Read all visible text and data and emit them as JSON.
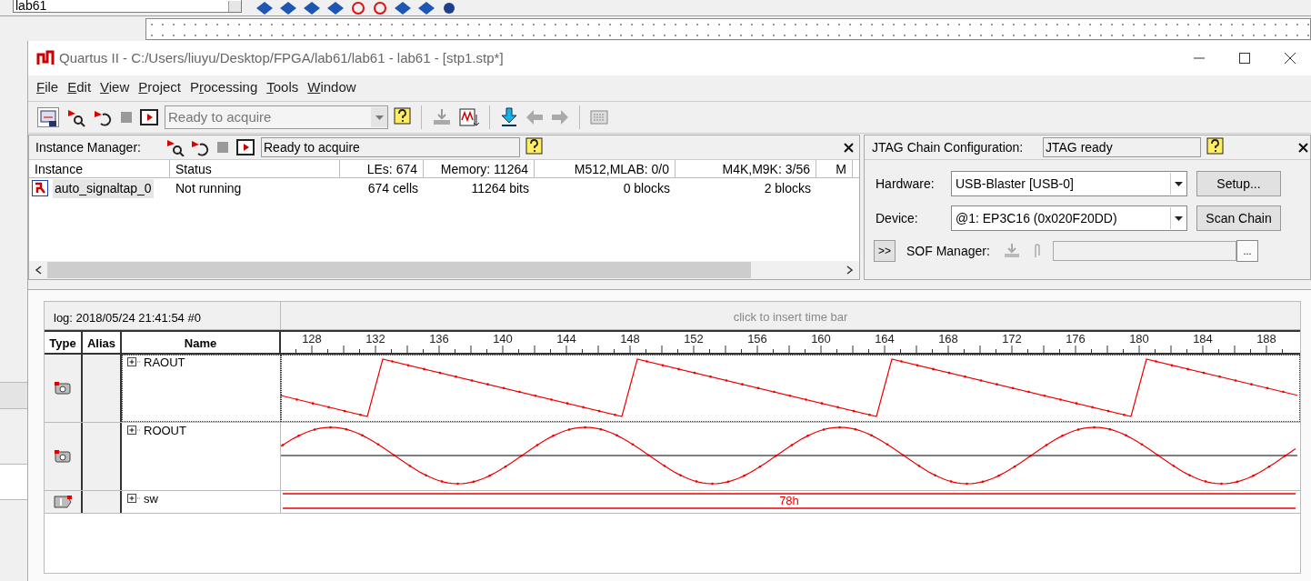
{
  "background_app": {
    "project_combo": "lab61"
  },
  "window": {
    "title": "Quartus II - C:/Users/liuyu/Desktop/FPGA/lab61/lab61 - lab61 - [stp1.stp*]"
  },
  "menu": [
    {
      "label": "File"
    },
    {
      "label": "Edit"
    },
    {
      "label": "View"
    },
    {
      "label": "Project"
    },
    {
      "label": "Processing"
    },
    {
      "label": "Tools"
    },
    {
      "label": "Window"
    }
  ],
  "toolbar": {
    "status_combo": "Ready to acquire"
  },
  "instance_manager": {
    "label": "Instance Manager:",
    "status": "Ready to acquire",
    "columns": [
      "Instance",
      "Status",
      "LEs: 674",
      "Memory: 11264",
      "M512,MLAB: 0/0",
      "M4K,M9K: 3/56",
      "M"
    ],
    "rows": [
      {
        "selected": true,
        "cells": [
          "auto_signaltap_0",
          "Not running",
          "674 cells",
          "11264 bits",
          "0 blocks",
          "2 blocks"
        ]
      }
    ]
  },
  "jtag": {
    "label": "JTAG Chain Configuration:",
    "status": "JTAG ready",
    "hardware_label": "Hardware:",
    "hardware": "USB-Blaster [USB-0]",
    "setup_button": "Setup...",
    "device_label": "Device:",
    "device": "@1: EP3C16 (0x020F20DD)",
    "scan_button": "Scan Chain",
    "expand_button": ">>",
    "sof_label": "SOF Manager:",
    "browse_button": "..."
  },
  "waveform": {
    "log": "log: 2018/05/24 21:41:54  #0",
    "time_bar_hint": "click to insert time bar",
    "columns": [
      "Type",
      "Alias",
      "Name"
    ],
    "ticks": [
      "128",
      "132",
      "136",
      "140",
      "144",
      "148",
      "152",
      "156",
      "160",
      "164",
      "168",
      "172",
      "176",
      "180",
      "184",
      "188"
    ],
    "signals": [
      {
        "name": "RAOUT",
        "kind": "sawtooth",
        "selected": true
      },
      {
        "name": "ROOUT",
        "kind": "sine",
        "selected": false
      },
      {
        "name": "sw",
        "kind": "bus",
        "value": "78h",
        "selected": false
      }
    ]
  }
}
